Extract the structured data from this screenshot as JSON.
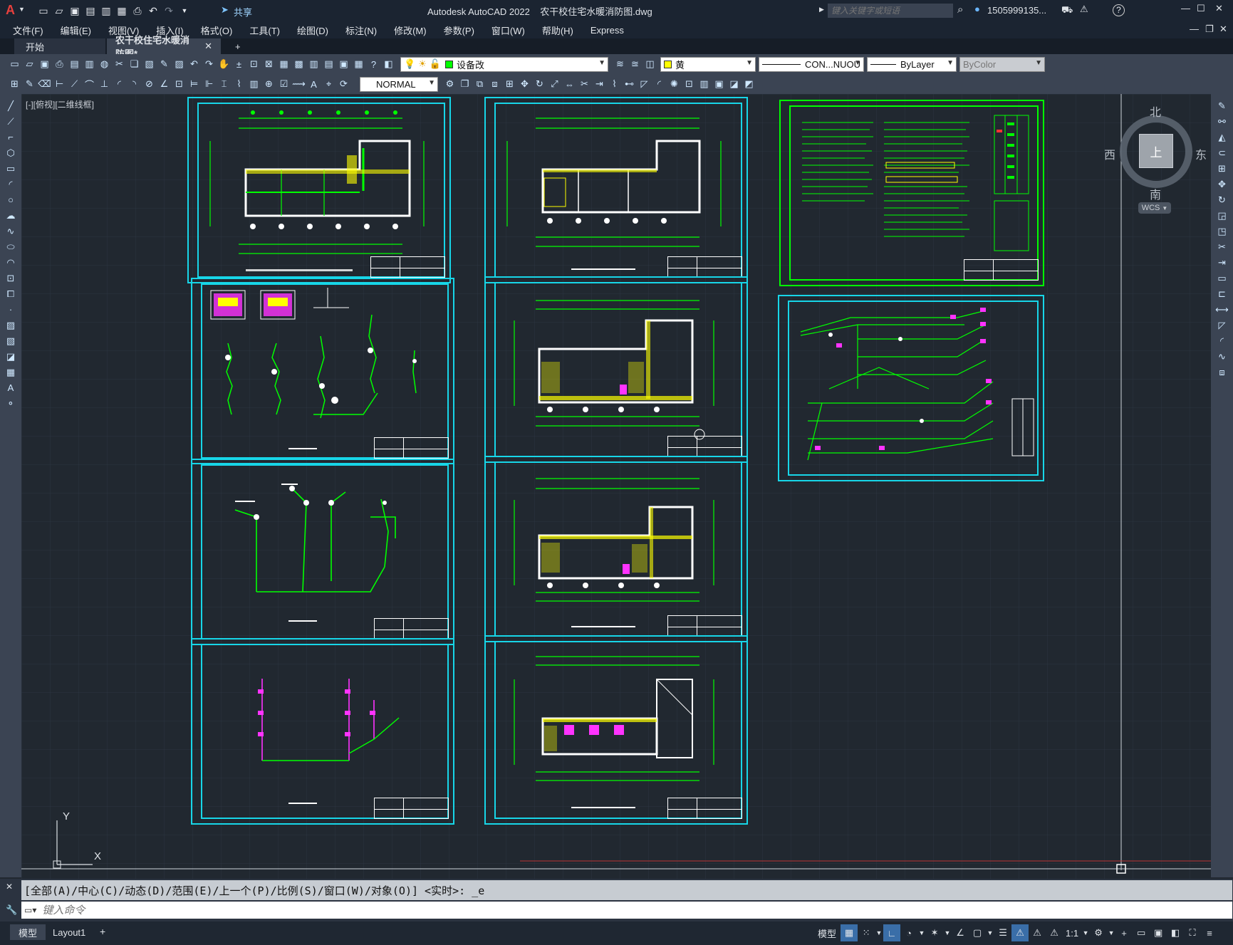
{
  "app": {
    "title": "Autodesk AutoCAD 2022",
    "filename": "农干校住宅水暖消防图.dwg",
    "share_label": "共享",
    "search_placeholder": "键入关键字或短语",
    "user": "1505999135...",
    "help": "?"
  },
  "menu": [
    "文件(F)",
    "编辑(E)",
    "视图(V)",
    "插入(I)",
    "格式(O)",
    "工具(T)",
    "绘图(D)",
    "标注(N)",
    "修改(M)",
    "参数(P)",
    "窗口(W)",
    "帮助(H)",
    "Express"
  ],
  "tabs": {
    "start": "开始",
    "active": "农干校住宅水暖消防图*",
    "add": "+"
  },
  "toolbar": {
    "layer": "设备改",
    "color": "黄",
    "linetype": "CON...NUOU",
    "lineweight": "ByLayer",
    "plotstyle": "ByColor",
    "dimstyle": "NORMAL"
  },
  "viewport": {
    "label": "[-][俯视][二维线框]"
  },
  "viewcube": {
    "north": "北",
    "south": "南",
    "east": "东",
    "west": "西",
    "face": "上",
    "wcs": "WCS"
  },
  "ucs": {
    "x": "X",
    "y": "Y"
  },
  "command": {
    "history": "[全部(A)/中心(C)/动态(D)/范围(E)/上一个(P)/比例(S)/窗口(W)/对象(O)] <实时>: _e",
    "placeholder": "键入命令"
  },
  "status": {
    "model_tab": "模型",
    "layout_tab": "Layout1",
    "add_tab": "+",
    "model_btn": "模型",
    "scale": "1:1"
  },
  "colors": {
    "sheet_border": "#17d6e8",
    "drawing_green": "#00ff00",
    "pink": "#ff33ff",
    "yellow": "#ffff00"
  }
}
